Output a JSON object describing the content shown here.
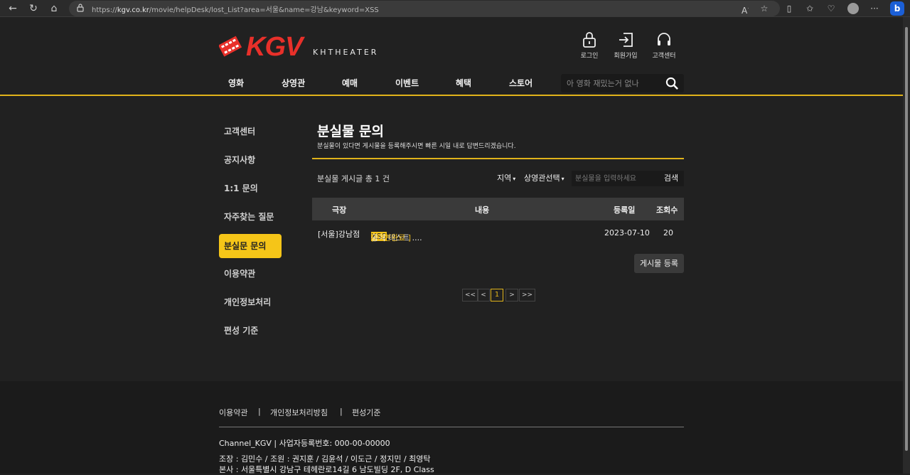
{
  "browser": {
    "url_prefix": "https://",
    "url_host": "kgv.co.kr",
    "url_path": "/movie/helpDesk/lost_List?area=서울&name=강남&keyword=XSS",
    "bing_label": "b"
  },
  "header": {
    "logo_text": "KGV",
    "logo_sub": "KHTHEATER",
    "util": [
      {
        "label": "로그인",
        "icon": "lock-icon"
      },
      {
        "label": "회원가입",
        "icon": "signup-icon"
      },
      {
        "label": "고객센터",
        "icon": "headset-icon"
      }
    ],
    "gnb": [
      "영화",
      "상영관",
      "예매",
      "이벤트",
      "혜택",
      "스토어"
    ],
    "search_placeholder": "아 영화 재밌는거 없나"
  },
  "sidebar": {
    "items": [
      "고객센터",
      "공지사항",
      "1:1 문의",
      "자주찾는 질문",
      "분실문 문의",
      "이용약관",
      "개인정보처리",
      "편성 기준"
    ],
    "active_index": 4
  },
  "main": {
    "title": "분실물 문의",
    "desc": "분실물이 있다면 게시물을 등록해주시면 빠른 시일 내로 답변드리겠습니다.",
    "count_text": "분실물 게시글 총 1 건",
    "filter": {
      "area_label": "지역",
      "theater_label": "상영관선택",
      "input_placeholder": "분실물을 입력하세요",
      "search_btn": "검색"
    },
    "table": {
      "headers": [
        "극장",
        "내용",
        "등록일",
        "조회수"
      ],
      "rows": [
        {
          "theater": "[서울]강남점",
          "keyword": "XSS",
          "content_rest": " 공격 테스트 ....",
          "reply": "[ 답변완료 ]",
          "date": "2023-07-10",
          "views": "20"
        }
      ]
    },
    "write_btn": "게시물 등록",
    "pagination": [
      "<<",
      "<",
      "1",
      ">",
      ">>"
    ],
    "current_page": "1"
  },
  "footer": {
    "links": [
      "이용약관",
      "개인정보처리방침",
      "편성기준"
    ],
    "separator": "|",
    "company": "Channel_KGV | 사업자등록번호: 000-00-00000",
    "members": "조장 : 김민수 / 조원 : 권지훈 / 김윤석 / 이도근 / 정지민 / 최영탁",
    "address": "본사 : 서울특별시 강남구 테헤란로14길 6 남도빌딩 2F, D Class"
  },
  "colors": {
    "accent": "#f5c518",
    "logo_red": "#e8302a",
    "background": "#212121"
  }
}
